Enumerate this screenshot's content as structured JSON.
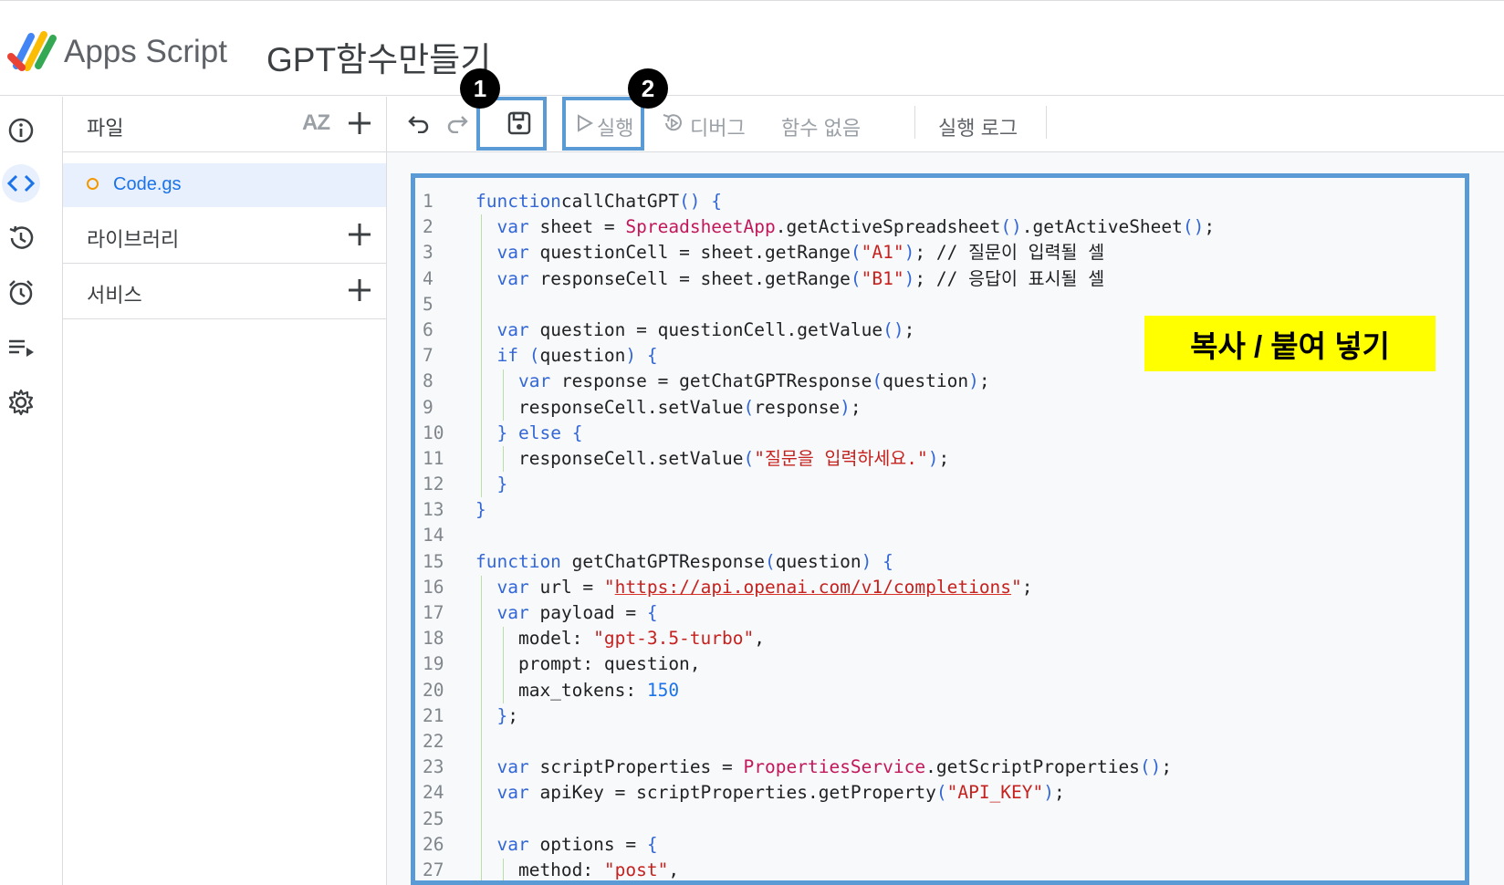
{
  "header": {
    "app_name": "Apps Script",
    "project_title": "GPT함수만들기"
  },
  "rail": [
    "info-icon",
    "code-icon",
    "history-icon",
    "trigger-icon",
    "executions-icon",
    "settings-icon"
  ],
  "files_panel": {
    "files_label": "파일",
    "sort_label": "AZ",
    "file_name": "Code.gs",
    "libraries_label": "라이브러리",
    "services_label": "서비스"
  },
  "toolbar": {
    "run_label": "실행",
    "debug_label": "디버그",
    "function_label": "함수 없음",
    "log_label": "실행 로그"
  },
  "annotations": {
    "badge_1": "1",
    "badge_2": "2",
    "callout": "복사 / 붙여 넣기"
  },
  "code": {
    "lines": [
      [
        [
          "kw",
          "function"
        ],
        [
          "",
          "callChatGPT"
        ],
        [
          "kw",
          "()"
        ],
        [
          "",
          ""
        ],
        [
          "kw",
          " {"
        ]
      ],
      [
        [
          "",
          "  "
        ],
        [
          "kw",
          "var"
        ],
        [
          "",
          " sheet = "
        ],
        [
          "cls",
          "SpreadsheetApp"
        ],
        [
          "",
          ".getActiveSpreadsheet"
        ],
        [
          "kw",
          "()"
        ],
        [
          "",
          ".getActiveSheet"
        ],
        [
          "kw",
          "()"
        ],
        [
          "",
          ";"
        ]
      ],
      [
        [
          "",
          "  "
        ],
        [
          "kw",
          "var"
        ],
        [
          "",
          " questionCell = sheet.getRange"
        ],
        [
          "kw",
          "("
        ],
        [
          "str",
          "\"A1\""
        ],
        [
          "kw",
          ")"
        ],
        [
          "",
          "; // 질문이 입력될 셀"
        ]
      ],
      [
        [
          "",
          "  "
        ],
        [
          "kw",
          "var"
        ],
        [
          "",
          " responseCell = sheet.getRange"
        ],
        [
          "kw",
          "("
        ],
        [
          "str",
          "\"B1\""
        ],
        [
          "kw",
          ")"
        ],
        [
          "",
          "; // 응답이 표시될 셀"
        ]
      ],
      [],
      [
        [
          "",
          "  "
        ],
        [
          "kw",
          "var"
        ],
        [
          "",
          " question = questionCell.getValue"
        ],
        [
          "kw",
          "()"
        ],
        [
          "",
          ";"
        ]
      ],
      [
        [
          "",
          "  "
        ],
        [
          "kw",
          "if"
        ],
        [
          "",
          " "
        ],
        [
          "kw",
          "("
        ],
        [
          "",
          "question"
        ],
        [
          "kw",
          ")"
        ],
        [
          "",
          ""
        ],
        [
          "kw",
          " {"
        ]
      ],
      [
        [
          "",
          "    "
        ],
        [
          "kw",
          "var"
        ],
        [
          "",
          " response = getChatGPTResponse"
        ],
        [
          "kw",
          "("
        ],
        [
          "",
          "question"
        ],
        [
          "kw",
          ")"
        ],
        [
          "",
          ";"
        ]
      ],
      [
        [
          "",
          "    responseCell.setValue"
        ],
        [
          "kw",
          "("
        ],
        [
          "",
          "response"
        ],
        [
          "kw",
          ")"
        ],
        [
          "",
          ";"
        ]
      ],
      [
        [
          "",
          "  "
        ],
        [
          "kw",
          "}"
        ],
        [
          "",
          " "
        ],
        [
          "kw",
          "else"
        ],
        [
          "kw",
          " {"
        ]
      ],
      [
        [
          "",
          "    responseCell.setValue"
        ],
        [
          "kw",
          "("
        ],
        [
          "str",
          "\"질문을 입력하세요.\""
        ],
        [
          "kw",
          ")"
        ],
        [
          "",
          ";"
        ]
      ],
      [
        [
          "",
          "  "
        ],
        [
          "kw",
          "}"
        ]
      ],
      [
        [
          "kw",
          "}"
        ]
      ],
      [],
      [
        [
          "kw",
          "function"
        ],
        [
          "",
          " getChatGPTResponse"
        ],
        [
          "kw",
          "("
        ],
        [
          "",
          "question"
        ],
        [
          "kw",
          ")"
        ],
        [
          "kw",
          " {"
        ]
      ],
      [
        [
          "",
          "  "
        ],
        [
          "kw",
          "var"
        ],
        [
          "",
          " url = "
        ],
        [
          "str",
          "\""
        ],
        [
          "url",
          "https://api.openai.com/v1/completions"
        ],
        [
          "str",
          "\""
        ],
        [
          "",
          ";"
        ]
      ],
      [
        [
          "",
          "  "
        ],
        [
          "kw",
          "var"
        ],
        [
          "",
          " payload = "
        ],
        [
          "kw",
          "{"
        ]
      ],
      [
        [
          "",
          "    model: "
        ],
        [
          "str",
          "\"gpt-3.5-turbo\""
        ],
        [
          "",
          ","
        ]
      ],
      [
        [
          "",
          "    prompt: question,"
        ]
      ],
      [
        [
          "",
          "    max_tokens: "
        ],
        [
          "num",
          "150"
        ]
      ],
      [
        [
          "",
          "  "
        ],
        [
          "kw",
          "}"
        ],
        [
          "",
          ";"
        ]
      ],
      [],
      [
        [
          "",
          "  "
        ],
        [
          "kw",
          "var"
        ],
        [
          "",
          " scriptProperties = "
        ],
        [
          "cls",
          "PropertiesService"
        ],
        [
          "",
          ".getScriptProperties"
        ],
        [
          "kw",
          "()"
        ],
        [
          "",
          ";"
        ]
      ],
      [
        [
          "",
          "  "
        ],
        [
          "kw",
          "var"
        ],
        [
          "",
          " apiKey = scriptProperties.getProperty"
        ],
        [
          "kw",
          "("
        ],
        [
          "str",
          "\"API_KEY\""
        ],
        [
          "kw",
          ")"
        ],
        [
          "",
          ";"
        ]
      ],
      [],
      [
        [
          "",
          "  "
        ],
        [
          "kw",
          "var"
        ],
        [
          "",
          " options = "
        ],
        [
          "kw",
          "{"
        ]
      ],
      [
        [
          "",
          "    method: "
        ],
        [
          "str",
          "\"post\""
        ],
        [
          "",
          ","
        ]
      ]
    ]
  }
}
